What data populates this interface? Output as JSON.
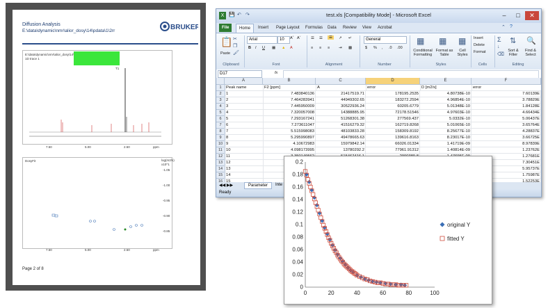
{
  "report": {
    "title": "Diffusion Analysis",
    "path": "E:\\data\\dynamic\\nmr\\alior_dosy\\14\\pdata\\1\\2rr",
    "logo_text": "BRUKER",
    "spectrum_path": "E:\\data\\dynamic\\nmr\\alior_dosy\\14\\pdata\\1\\2rr",
    "spectrum_trace": "1D trace 1",
    "top_label": "T1",
    "x_ticks": [
      "7.50",
      "5.00",
      "2.50",
      "ppm"
    ],
    "dosy_label": "DosyFit",
    "y_axis_label": "log(m2/s)",
    "y_axis_sub": "x10^1",
    "y_ticks": [
      "-1.05",
      "-1.00",
      "-0.95",
      "-0.90",
      "-0.85"
    ],
    "peak_labels": [
      "1",
      "2",
      "3",
      "4",
      "5",
      "6",
      "7",
      "8",
      "9",
      "10",
      "11",
      "12",
      "13",
      "14",
      "15"
    ],
    "page_text": "Page 2 of 8"
  },
  "excel": {
    "title": "test.xls  [Compatibility Mode]  -  Microsoft Excel",
    "tabs": [
      "File",
      "Home",
      "Insert",
      "Page Layout",
      "Formulas",
      "Data",
      "Review",
      "View",
      "Acrobat"
    ],
    "font_name": "Arial",
    "font_size": "10",
    "number_format": "General",
    "groups": [
      "Clipboard",
      "Font",
      "Alignment",
      "Number",
      "Styles",
      "Cells",
      "Editing"
    ],
    "ribbon": {
      "paste": "Paste",
      "conditional": "Conditional Formatting",
      "format_table": "Format as Table",
      "cell_styles": "Cell Styles",
      "insert": "Insert",
      "delete": "Delete",
      "format": "Format",
      "sort": "Sort & Filter",
      "find": "Find & Select"
    },
    "name_box": "D17",
    "fx": "fx",
    "columns": [
      "A",
      "B",
      "C",
      "D",
      "E",
      "F"
    ],
    "rows": [
      [
        "1",
        "Peak name",
        "F2 [ppm]",
        "A",
        "error",
        "D [m2/s]",
        "error"
      ],
      [
        "2",
        "1",
        "7.483840136",
        "21417519.71",
        "178195.2535",
        "4.80738E-10",
        "7.60139E"
      ],
      [
        "3",
        "2",
        "7.464283941",
        "44949302.65",
        "183272.2594",
        "4.96854E-10",
        "3.78829E"
      ],
      [
        "4",
        "3",
        "7.445950009",
        "30522936.24",
        "60205.6779",
        "5.01348E-10",
        "1.84128E"
      ],
      [
        "5",
        "4",
        "7.320057008",
        "14388885.95",
        "72178.51546",
        "4.97603E-10",
        "4.66434E"
      ],
      [
        "6",
        "5",
        "7.293167241",
        "51268301.38",
        "277569.437",
        "5.0332E-10",
        "5.06437E"
      ],
      [
        "7",
        "6",
        "7.273611047",
        "41516279.32",
        "162719.8268",
        "5.01065E-10",
        "3.65764E"
      ],
      [
        "8",
        "7",
        "5.515998083",
        "48103833.28",
        "158309.8192",
        "8.25677E-10",
        "4.28837E"
      ],
      [
        "9",
        "8",
        "5.295990897",
        "49478665.63",
        "139616.8163",
        "8.23017E-10",
        "3.66725E"
      ],
      [
        "10",
        "9",
        "4.10672983",
        "15979842.14",
        "66026.01334",
        "1.41719E-09",
        "8.97839E"
      ],
      [
        "11",
        "10",
        "4.098173995",
        "13780292.2",
        "77961.91312",
        "1.40814E-09",
        "1.23762E"
      ],
      [
        "12",
        "11",
        "3.350149562",
        "515467416.1",
        "2900389.8",
        "1.47695E-09",
        "1.27681E"
      ],
      [
        "13",
        "12",
        "3.006693899",
        "17705611.58",
        "59861.78436",
        "1.40938E-09",
        "7.30451E"
      ],
      [
        "14",
        "13",
        "2",
        "",
        "",
        "",
        "5.95737E"
      ],
      [
        "15",
        "14",
        "2",
        "",
        "",
        "",
        "1.75987E"
      ],
      [
        "16",
        "15",
        "2",
        "",
        "",
        "",
        "1.52253E"
      ],
      [
        "17",
        "",
        "",
        "",
        "",
        "",
        ""
      ],
      [
        "18",
        "",
        "",
        "",
        "",
        "",
        ""
      ]
    ],
    "sheet_tab": "Parameter",
    "sheet_tab2": "Inte",
    "status": "Ready"
  },
  "chart_data": {
    "type": "scatter",
    "title": "",
    "xlabel": "",
    "ylabel": "",
    "xlim": [
      0,
      100
    ],
    "ylim": [
      0,
      0.2
    ],
    "x_ticks": [
      0,
      20,
      40,
      60,
      80,
      100
    ],
    "y_ticks": [
      0,
      0.02,
      0.04,
      0.06,
      0.08,
      0.1,
      0.12,
      0.14,
      0.16,
      0.18,
      0.2
    ],
    "x_tick_labels": [
      "0",
      "20",
      "40",
      "60",
      "80",
      "100"
    ],
    "y_tick_labels": [
      "0",
      "0.02",
      "0.04",
      "0.06",
      "0.08",
      "0.1",
      "0.12",
      "0.14",
      "0.16",
      "0.18",
      "0.2"
    ],
    "legend_position": "right",
    "series": [
      {
        "name": "original Y",
        "color": "#3b6fb6",
        "marker": "diamond",
        "x": [
          1,
          3,
          5,
          7,
          9,
          11,
          13,
          15,
          17,
          19,
          21,
          23,
          25,
          27,
          29,
          31,
          33,
          35,
          37,
          40,
          43,
          46,
          49,
          52,
          55,
          58,
          62,
          66,
          70,
          74,
          77
        ],
        "y": [
          0.18,
          0.168,
          0.155,
          0.143,
          0.131,
          0.118,
          0.106,
          0.095,
          0.085,
          0.076,
          0.067,
          0.059,
          0.052,
          0.046,
          0.041,
          0.036,
          0.031,
          0.027,
          0.024,
          0.019,
          0.016,
          0.013,
          0.011,
          0.009,
          0.008,
          0.007,
          0.006,
          0.005,
          0.004,
          0.004,
          0.003
        ]
      },
      {
        "name": "fitted Y",
        "color": "#d04f3f",
        "marker": "square",
        "x": [
          0,
          1,
          2,
          3,
          4,
          5,
          6,
          7,
          8,
          9,
          10,
          11,
          12,
          13,
          14,
          15,
          16,
          17,
          18,
          19,
          20,
          21,
          22,
          23,
          24,
          25,
          26,
          27,
          28,
          29,
          30,
          31,
          32,
          33,
          34,
          35,
          36,
          37,
          38,
          39,
          40,
          42,
          44,
          46,
          48,
          50,
          52,
          54,
          56,
          58,
          60,
          62,
          64,
          66,
          68,
          70,
          72,
          74,
          76,
          78
        ],
        "y": [
          0.185,
          0.179,
          0.172,
          0.166,
          0.16,
          0.154,
          0.148,
          0.141,
          0.135,
          0.129,
          0.123,
          0.117,
          0.111,
          0.105,
          0.099,
          0.094,
          0.089,
          0.084,
          0.079,
          0.075,
          0.07,
          0.066,
          0.062,
          0.058,
          0.055,
          0.051,
          0.048,
          0.045,
          0.042,
          0.04,
          0.037,
          0.035,
          0.033,
          0.031,
          0.029,
          0.027,
          0.025,
          0.024,
          0.022,
          0.021,
          0.019,
          0.017,
          0.015,
          0.013,
          0.012,
          0.01,
          0.009,
          0.008,
          0.007,
          0.007,
          0.006,
          0.005,
          0.005,
          0.004,
          0.004,
          0.004,
          0.003,
          0.003,
          0.003,
          0.003
        ]
      }
    ]
  }
}
